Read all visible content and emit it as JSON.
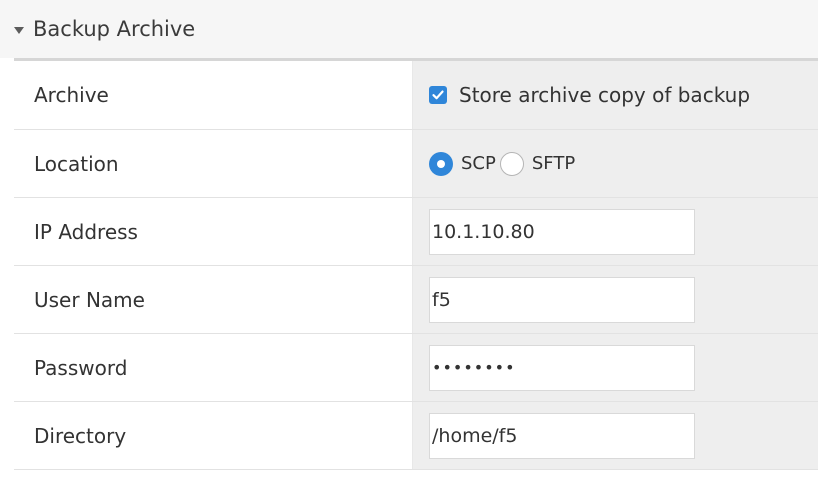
{
  "section": {
    "title": "Backup Archive",
    "collapse_icon": "triangle-down-icon"
  },
  "rows": {
    "archive": {
      "label": "Archive",
      "checkbox_checked": true,
      "checkbox_label": "Store archive copy of backup"
    },
    "location": {
      "label": "Location",
      "options": [
        "SCP",
        "SFTP"
      ],
      "selected": "SCP"
    },
    "ip_address": {
      "label": "IP Address",
      "value": "10.1.10.80"
    },
    "user_name": {
      "label": "User Name",
      "value": "f5"
    },
    "password": {
      "label": "Password",
      "value": "••••••••"
    },
    "directory": {
      "label": "Directory",
      "value": "/home/f5"
    }
  },
  "colors": {
    "accent": "#2f86d9",
    "header_bg": "#f6f6f6",
    "value_bg": "#eeeeee"
  }
}
